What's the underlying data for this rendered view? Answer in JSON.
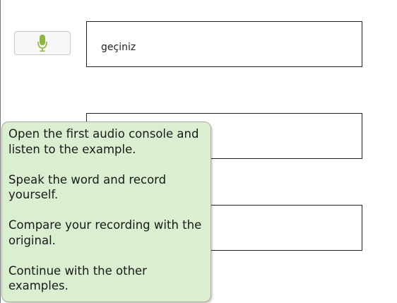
{
  "exercise": {
    "rows": [
      {
        "word": "geçiniz",
        "mic_icon": "microphone-icon"
      },
      {
        "word": ""
      },
      {
        "word": ""
      }
    ]
  },
  "instructions": {
    "steps": [
      "Open the first audio console and listen to the example.",
      "Speak the word and record yourself.",
      "Compare your recording with the original.",
      "Continue with the other examples."
    ]
  },
  "colors": {
    "mic_icon": "#8db63c",
    "tooltip_background": "#d9efd0",
    "box_border": "#222222"
  }
}
